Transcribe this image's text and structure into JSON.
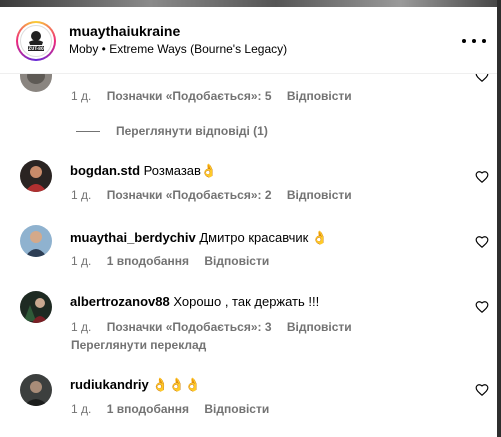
{
  "header": {
    "username": "muaythaiukraine",
    "song": "Moby • Extreme Ways (Bourne's Legacy)",
    "logo_text": "ZUT-80"
  },
  "comments": [
    {
      "user": "",
      "text": "",
      "meta": {
        "time": "1 д.",
        "likes": "Позначки «Подобається»: 5",
        "reply": "Відповісти"
      }
    },
    {
      "user": "bogdan.std",
      "text": "Розмазав👌",
      "meta": {
        "time": "1 д.",
        "likes": "Позначки «Подобається»: 2",
        "reply": "Відповісти"
      }
    },
    {
      "user": "muaythai_berdychiv",
      "text": "Дмитро красавчик 👌",
      "meta": {
        "time": "1 д.",
        "likes": "1 вподобання",
        "reply": "Відповісти"
      }
    },
    {
      "user": "albertrozanov88",
      "text": "Хорошо , так держать !!!",
      "meta": {
        "time": "1 д.",
        "likes": "Позначки «Подобається»: 3",
        "reply": "Відповісти"
      },
      "translate": "Переглянути переклад"
    },
    {
      "user": "rudiukandriy",
      "text": "👌👌👌",
      "meta": {
        "time": "1 д.",
        "likes": "1 вподобання",
        "reply": "Відповісти"
      }
    }
  ],
  "view_replies": "Переглянути відповіді (1)"
}
